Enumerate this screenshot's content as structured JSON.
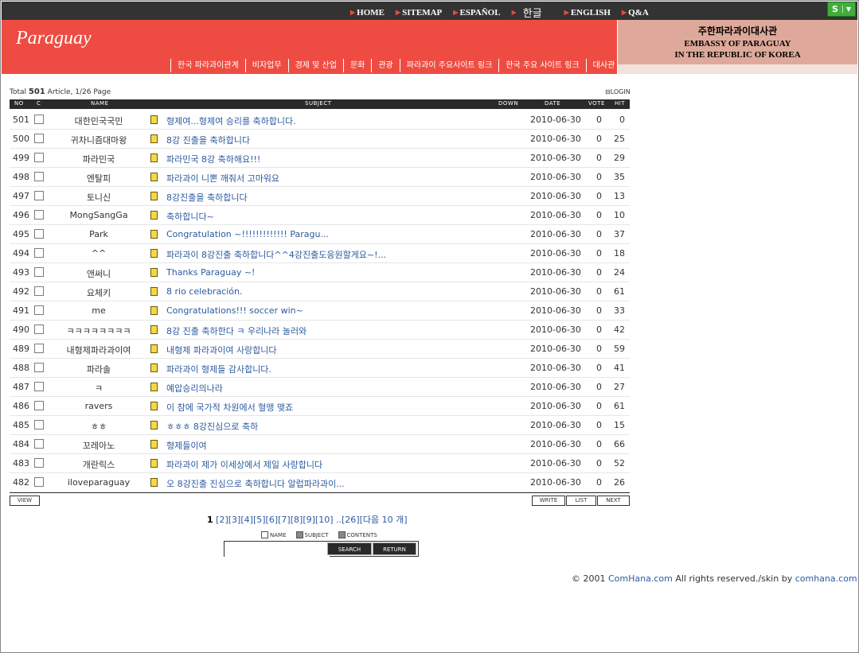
{
  "top_nav": [
    "HOME",
    "SITEMAP",
    "ESPAÑOL",
    "한글",
    "ENGLISH",
    "Q&A"
  ],
  "s_button": "S",
  "logo": "Paraguay",
  "menu": [
    "한국 파라과이관계",
    "비자업무",
    "경제 및 산업",
    "문화",
    "관광",
    "파라과이 주요사이트 링크",
    "한국 주요 사이트 링크",
    "대사관 소개"
  ],
  "embassy": {
    "kr": "주한파라과이대사관",
    "en1": "EMBASSY OF PARAGUAY",
    "en2": "IN THE REPUBLIC OF KOREA"
  },
  "board": {
    "total_prefix": "Total",
    "total": "501",
    "total_suffix": "Article, 1/26 Page",
    "login": "LOGIN",
    "headers": {
      "no": "NO",
      "c": "C",
      "name": "NAME",
      "subject": "SUBJECT",
      "down": "DOWN",
      "date": "DATE",
      "vote": "VOTE",
      "hit": "HIT"
    },
    "rows": [
      {
        "no": "501",
        "name": "대한민국국민",
        "subject": "형제여...형제여 승리를 축하합니다.",
        "date": "2010-06-30",
        "vote": "0",
        "hit": "0"
      },
      {
        "no": "500",
        "name": "귀차니즘대마왕",
        "subject": "8강 진출을 축하합니다",
        "date": "2010-06-30",
        "vote": "0",
        "hit": "25"
      },
      {
        "no": "499",
        "name": "파라민국",
        "subject": "파라민국 8강 축하해요!!!",
        "date": "2010-06-30",
        "vote": "0",
        "hit": "29"
      },
      {
        "no": "498",
        "name": "엔탈피",
        "subject": "파라과이 니뽄 깨줘서 고마워요",
        "date": "2010-06-30",
        "vote": "0",
        "hit": "35"
      },
      {
        "no": "497",
        "name": "토니신",
        "subject": "8강진출을 축하합니다",
        "date": "2010-06-30",
        "vote": "0",
        "hit": "13"
      },
      {
        "no": "496",
        "name": "MongSangGa",
        "subject": "축하합니다~",
        "date": "2010-06-30",
        "vote": "0",
        "hit": "10"
      },
      {
        "no": "495",
        "name": "Park",
        "subject": "Congratulation ~!!!!!!!!!!!!! Paragu...",
        "date": "2010-06-30",
        "vote": "0",
        "hit": "37"
      },
      {
        "no": "494",
        "name": "^^",
        "subject": "파라과이 8강진출 축하합니다^^4강진출도응원할게요~!...",
        "date": "2010-06-30",
        "vote": "0",
        "hit": "18"
      },
      {
        "no": "493",
        "name": "앤써니",
        "subject": "Thanks Paraguay ~!",
        "date": "2010-06-30",
        "vote": "0",
        "hit": "24"
      },
      {
        "no": "492",
        "name": "요체키",
        "subject": "8 rio celebración.",
        "date": "2010-06-30",
        "vote": "0",
        "hit": "61"
      },
      {
        "no": "491",
        "name": "me",
        "subject": "Congratulations!!! soccer win~",
        "date": "2010-06-30",
        "vote": "0",
        "hit": "33"
      },
      {
        "no": "490",
        "name": "ㅋㅋㅋㅋㅋㅋㅋㅋ",
        "subject": "8강 진출 축하한다 ㅋ 우리나라 놀러와",
        "date": "2010-06-30",
        "vote": "0",
        "hit": "42"
      },
      {
        "no": "489",
        "name": "내형제파라과이여",
        "subject": "내형제 파라과이여 사랑합니다",
        "date": "2010-06-30",
        "vote": "0",
        "hit": "59"
      },
      {
        "no": "488",
        "name": "파라솔",
        "subject": "파라과이 형제들 감사합니다.",
        "date": "2010-06-30",
        "vote": "0",
        "hit": "41"
      },
      {
        "no": "487",
        "name": "ㅋ",
        "subject": "예압승리의나라",
        "date": "2010-06-30",
        "vote": "0",
        "hit": "27"
      },
      {
        "no": "486",
        "name": "ravers",
        "subject": "이 참에 국가적 차원에서 혈맹 맺죠",
        "date": "2010-06-30",
        "vote": "0",
        "hit": "61"
      },
      {
        "no": "485",
        "name": "ㅎㅎ",
        "subject": "ㅎㅎㅎ 8강진심으로 축하",
        "date": "2010-06-30",
        "vote": "0",
        "hit": "15"
      },
      {
        "no": "484",
        "name": "꼬레아노",
        "subject": "형제들이여",
        "date": "2010-06-30",
        "vote": "0",
        "hit": "66"
      },
      {
        "no": "483",
        "name": "개란릭스",
        "subject": "파라과이 제가 이세상에서 제일 사랑합니다",
        "date": "2010-06-30",
        "vote": "0",
        "hit": "52"
      },
      {
        "no": "482",
        "name": "iloveparaguay",
        "subject": "오 8강진출 진심으로 축하합니다 알럽파라과이...",
        "date": "2010-06-30",
        "vote": "0",
        "hit": "26"
      }
    ],
    "buttons": {
      "view": "VIEW",
      "write": "WRITE",
      "list": "LIST",
      "next": "NEXT"
    },
    "pager": {
      "current": "1",
      "pages": [
        "[2]",
        "[3]",
        "[4]",
        "[5]",
        "[6]",
        "[7]",
        "[8]",
        "[9]",
        "[10]"
      ],
      "ellipsis": "..",
      "last": "[26]",
      "next10": "[다음 10 개]"
    },
    "search": {
      "opt_name": "NAME",
      "opt_subject": "SUBJECT",
      "opt_contents": "CONTENTS",
      "search_btn": "SEARCH",
      "return_btn": "RETURN"
    }
  },
  "footer": {
    "prefix": "© 2001",
    "brand1": "ComHana.com",
    "middle": "All rights reserved./skin by",
    "brand2": "comhana.com"
  },
  "colors": {
    "header_red": "#ee4c42",
    "embassy_bg": "#dea99a",
    "topbar": "#333333",
    "link_blue": "#2c5aa0"
  }
}
